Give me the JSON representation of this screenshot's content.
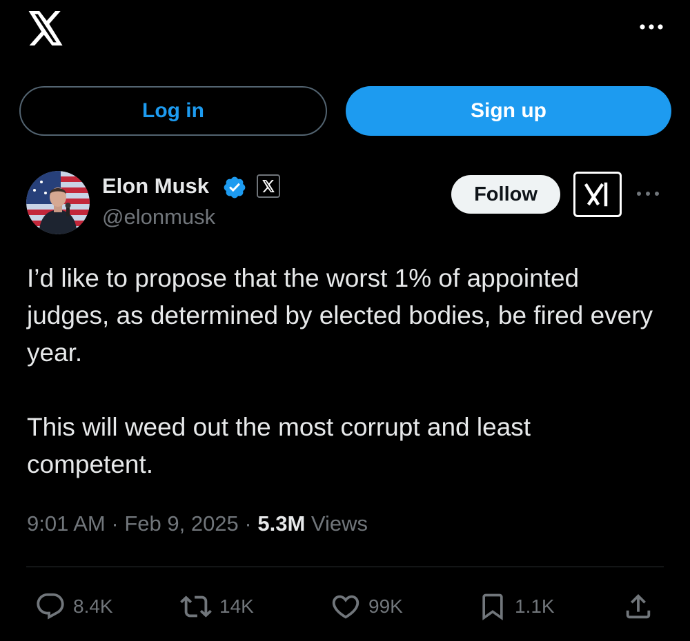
{
  "header": {
    "logo_icon": "x-logo-icon",
    "more_icon": "more-horizontal-icon"
  },
  "auth": {
    "login_label": "Log in",
    "signup_label": "Sign up"
  },
  "tweet": {
    "author": {
      "name": "Elon Musk",
      "handle": "@elonmusk",
      "verified": true,
      "affiliate_badge_icon": "x-affiliate-icon"
    },
    "follow_label": "Follow",
    "grok_icon": "xai-grok-icon",
    "text": [
      "I’d like to propose that the worst 1% of appointed judges, as determined by elected bodies, be fired every year.",
      "This will weed out the most corrupt and least competent."
    ],
    "time": "9:01 AM",
    "date": "Feb 9, 2025",
    "separator": "·",
    "views_count": "5.3M",
    "views_label": "Views",
    "stats": {
      "replies": "8.4K",
      "reposts": "14K",
      "likes": "99K",
      "bookmarks": "1.1K"
    }
  },
  "colors": {
    "background": "#000000",
    "accent": "#1d9bf0",
    "text_primary": "#e7e9ea",
    "text_secondary": "#71767b",
    "border": "#2f3336"
  }
}
